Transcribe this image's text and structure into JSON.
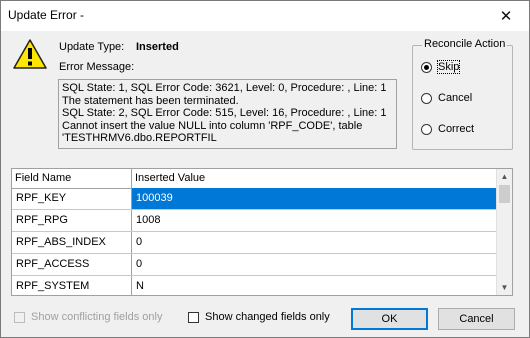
{
  "window": {
    "title": "Update Error -",
    "close_glyph": "✕"
  },
  "icons": {
    "warning": "warning-icon",
    "close": "close-icon"
  },
  "header": {
    "update_type_label": "Update Type:",
    "update_type_value": "Inserted",
    "error_message_label": "Error Message:"
  },
  "error_message": {
    "lines": [
      "SQL State: 1, SQL Error Code: 3621, Level: 0, Procedure: , Line: 1",
      "The statement has been terminated.",
      "SQL State: 2, SQL Error Code: 515, Level: 16, Procedure: , Line: 1",
      "Cannot insert the value NULL into column 'RPF_CODE', table",
      "'TESTHRMV6.dbo.REPORTFIL"
    ]
  },
  "reconcile": {
    "title": "Reconcile Action",
    "options": [
      {
        "label": "Skip",
        "checked": true
      },
      {
        "label": "Cancel",
        "checked": false
      },
      {
        "label": "Correct",
        "checked": false
      }
    ]
  },
  "grid": {
    "columns": [
      "Field Name",
      "Inserted Value"
    ],
    "rows": [
      {
        "field": "RPF_KEY",
        "value": "100039",
        "selected": true
      },
      {
        "field": "RPF_RPG",
        "value": "1008",
        "selected": false
      },
      {
        "field": "RPF_ABS_INDEX",
        "value": "0",
        "selected": false
      },
      {
        "field": "RPF_ACCESS",
        "value": "0",
        "selected": false
      },
      {
        "field": "RPF_SYSTEM",
        "value": "N",
        "selected": false
      }
    ]
  },
  "footer": {
    "show_conflicting_label": "Show conflicting fields only",
    "show_changed_label": "Show changed fields only",
    "ok_label": "OK",
    "cancel_label": "Cancel"
  },
  "colors": {
    "selection": "#0078d7",
    "warning_fill": "#ffe600"
  }
}
